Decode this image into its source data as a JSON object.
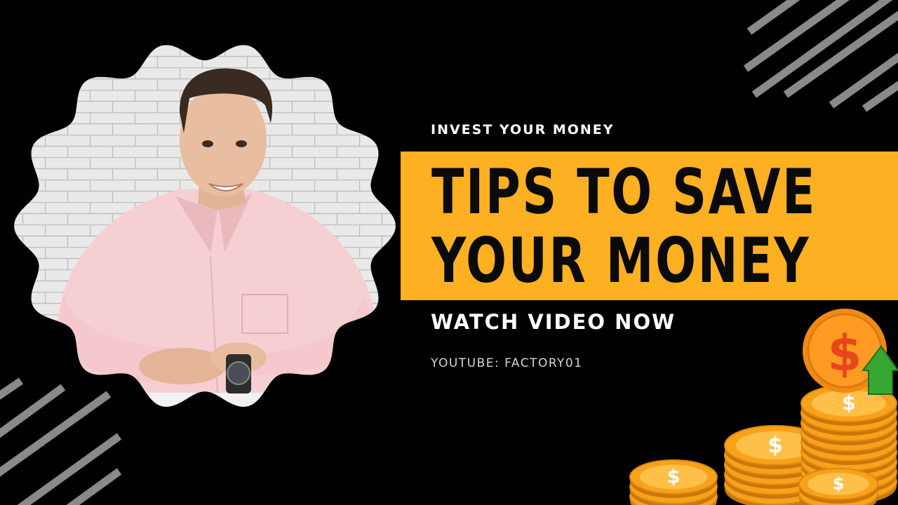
{
  "eyebrow": "INVEST YOUR MONEY",
  "title": {
    "line1": "TIPS TO SAVE",
    "line2": "YOUR MONEY"
  },
  "cta": "WATCH VIDEO NOW",
  "channel": "YOUTUBE: FACTORY01",
  "colors": {
    "background": "#000000",
    "accent": "#fcb022",
    "stripes": "#8a8a8a",
    "coin": "#f7a21a",
    "arrow": "#36a832"
  },
  "icons": {
    "coins": "dollar-coin-stacks-icon",
    "arrow": "up-arrow-icon"
  }
}
